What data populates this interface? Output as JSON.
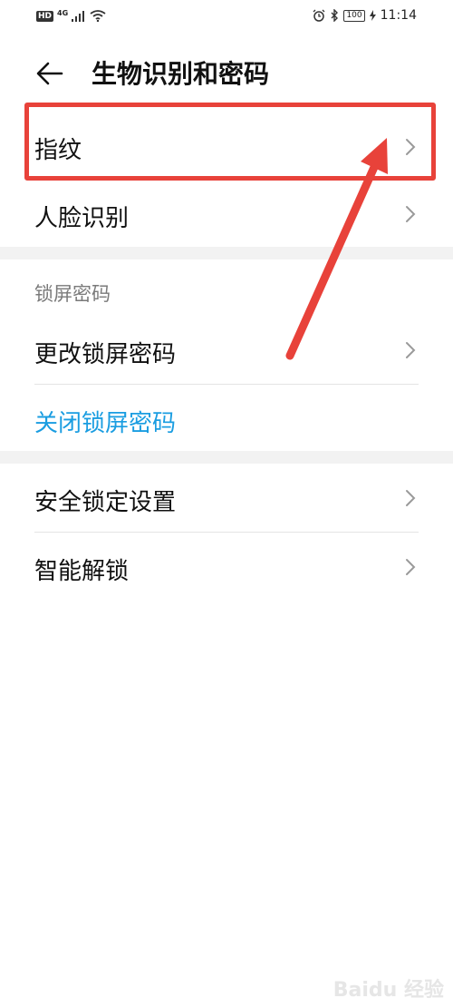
{
  "status_bar": {
    "network_badge": "HD",
    "network_type": "4G",
    "battery": "100",
    "time": "11:14",
    "icons": [
      "signal-icon",
      "wifi-icon",
      "alarm-icon",
      "bluetooth-icon",
      "battery-icon",
      "charging-icon"
    ]
  },
  "header": {
    "back_icon": "arrow-left-icon",
    "title": "生物识别和密码"
  },
  "section1": {
    "items": [
      {
        "label": "指纹",
        "icon": "chevron-right-icon"
      },
      {
        "label": "人脸识别",
        "icon": "chevron-right-icon"
      }
    ]
  },
  "section2": {
    "header": "锁屏密码",
    "items": [
      {
        "label": "更改锁屏密码",
        "icon": "chevron-right-icon"
      }
    ],
    "link": "关闭锁屏密码"
  },
  "section3": {
    "items": [
      {
        "label": "安全锁定设置",
        "icon": "chevron-right-icon"
      },
      {
        "label": "智能解锁",
        "icon": "chevron-right-icon"
      }
    ]
  },
  "annotation": {
    "highlight_color": "#e8423a"
  },
  "colors": {
    "link": "#1a9de1",
    "section_header": "#7a7a7a",
    "section_gap": "#f2f2f2"
  },
  "watermark": "Baidu 经验"
}
